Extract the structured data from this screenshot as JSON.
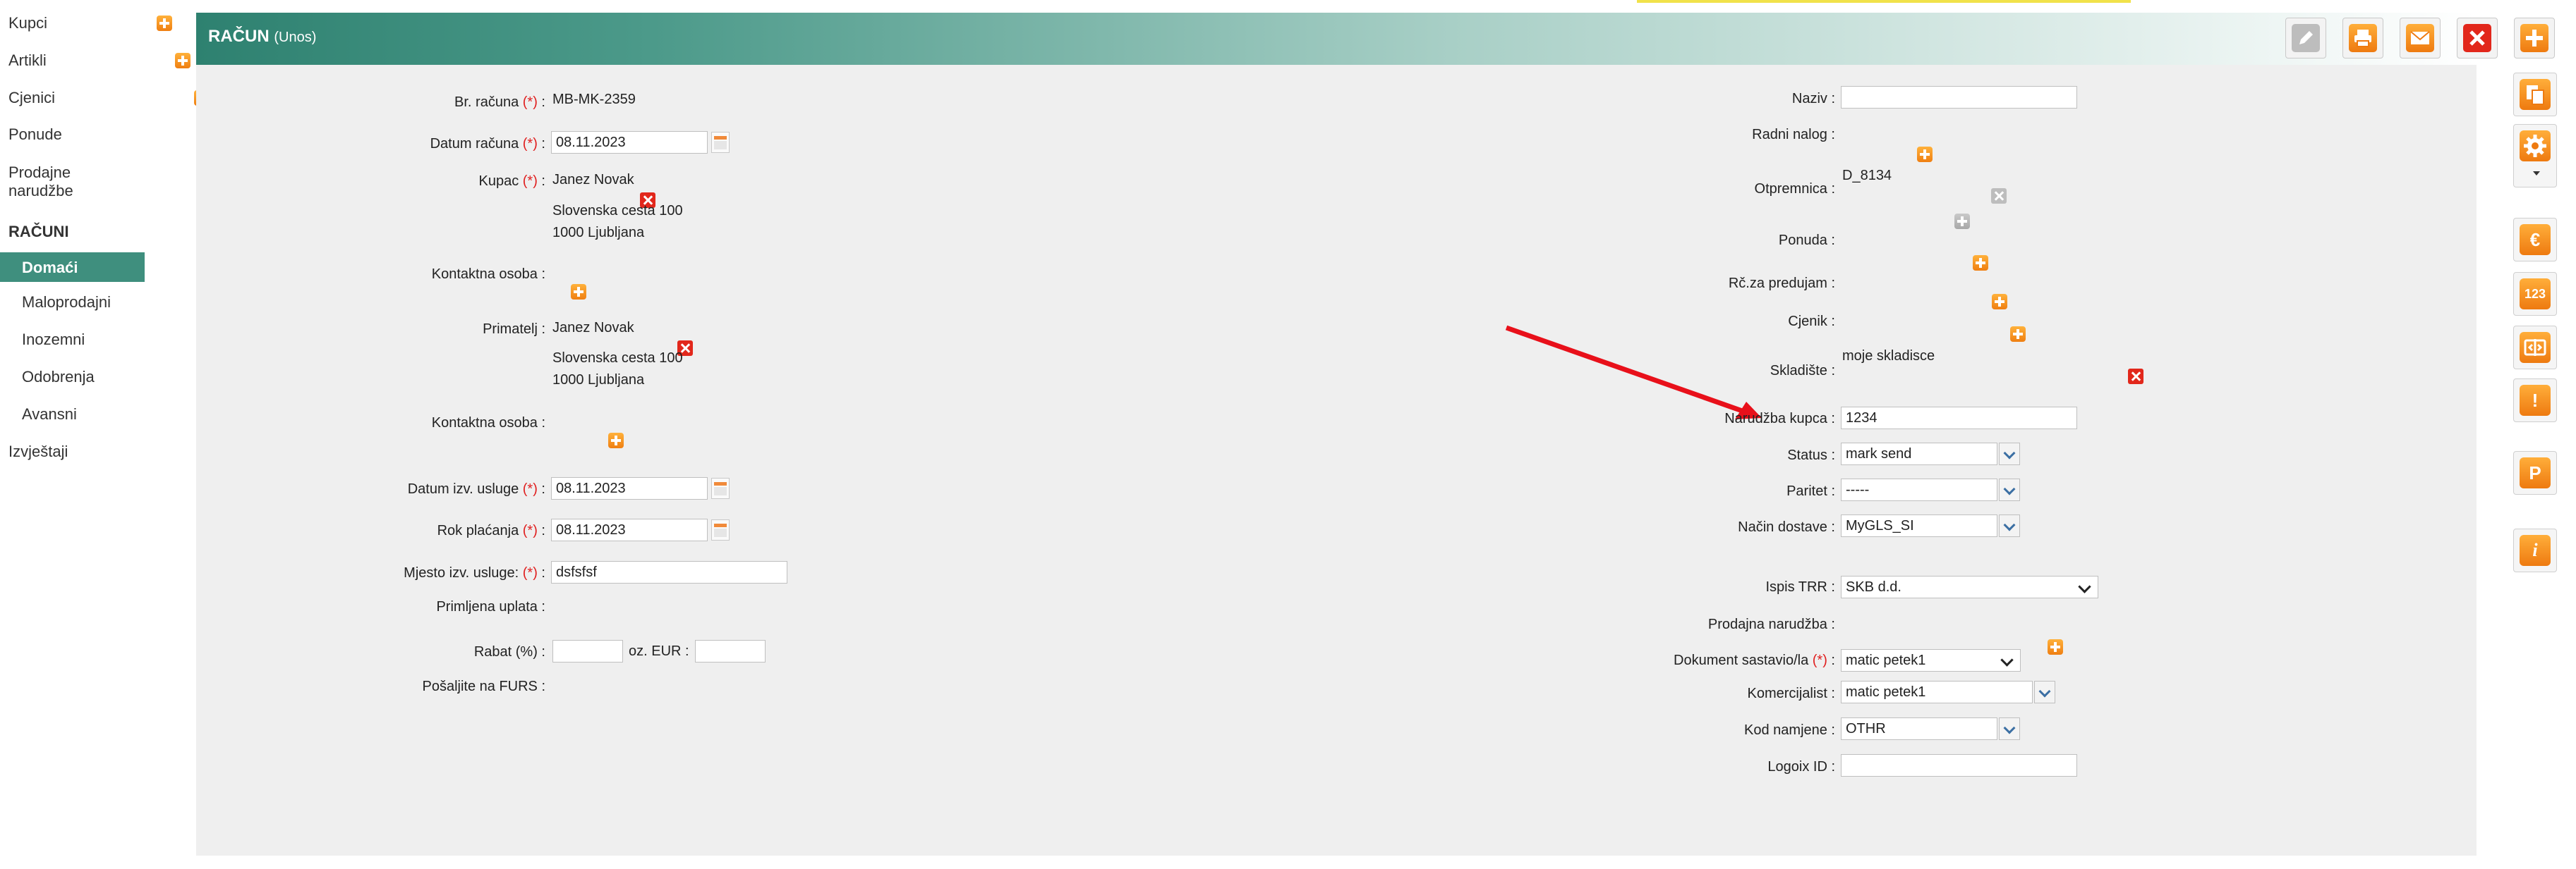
{
  "sidebar": {
    "items": [
      {
        "label": "Kupci"
      },
      {
        "label": "Artikli"
      },
      {
        "label": "Cjenici"
      },
      {
        "label": "Ponude"
      },
      {
        "label": "Prodajne narudžbe"
      }
    ],
    "section_title": "RAČUNI",
    "sub_items": [
      {
        "label": "Domaći",
        "active": true
      },
      {
        "label": "Maloprodajni"
      },
      {
        "label": "Inozemni"
      },
      {
        "label": "Odobrenja"
      },
      {
        "label": "Avansni"
      }
    ],
    "footer_item": "Izvještaji"
  },
  "header": {
    "title": "RAČUN",
    "subtitle": "(Unos)",
    "accent_color": "#2e8170"
  },
  "toolbar": {
    "buttons": [
      "edit-icon",
      "print-icon",
      "email-icon",
      "close-icon",
      "add-icon"
    ]
  },
  "form_left": {
    "br_racuna": {
      "label": "Br. računa",
      "req": "(*)",
      "value": "MB-MK-2359"
    },
    "datum_racuna": {
      "label": "Datum računa",
      "req": "(*)",
      "value": "08.11.2023"
    },
    "kupac": {
      "label": "Kupac",
      "req": "(*)",
      "name": "Janez Novak",
      "address1": "Slovenska cesta 100",
      "address2": "1000 Ljubljana"
    },
    "kontaktna_osoba_1": {
      "label": "Kontaktna osoba :"
    },
    "primatelj": {
      "label": "Primatelj :",
      "name": "Janez Novak",
      "address1": "Slovenska cesta 100",
      "address2": "1000 Ljubljana"
    },
    "kontaktna_osoba_2": {
      "label": "Kontaktna osoba :"
    },
    "datum_izv_usluge": {
      "label": "Datum izv. usluge",
      "req": "(*)",
      "value": "08.11.2023"
    },
    "rok_placanja": {
      "label": "Rok plaćanja",
      "req": "(*)",
      "value": "08.11.2023"
    },
    "mjesto_izv_usluge": {
      "label": "Mjesto izv. usluge:",
      "req": "(*)",
      "value": "dsfsfsf"
    },
    "primljena_uplata": {
      "label": "Primljena uplata :"
    },
    "rabat": {
      "label": "Rabat (%) :",
      "value": "",
      "oz_label": "oz. EUR :",
      "eur_value": ""
    },
    "posaljite_furs": {
      "label": "Pošaljite na FURS :"
    }
  },
  "form_right": {
    "naziv": {
      "label": "Naziv :",
      "value": ""
    },
    "radni_nalog": {
      "label": "Radni nalog :"
    },
    "otpremnica": {
      "label": "Otpremnica :",
      "value": "D_8134"
    },
    "ponuda": {
      "label": "Ponuda :"
    },
    "rc_za_predujam": {
      "label": "Rč.za predujam :"
    },
    "cjenik": {
      "label": "Cjenik :"
    },
    "skladiste": {
      "label": "Skladište :",
      "value": "moje skladisce"
    },
    "narudzba_kupca": {
      "label": "Narudžba kupca :",
      "value": "1234"
    },
    "status": {
      "label": "Status :",
      "value": "mark send"
    },
    "paritet": {
      "label": "Paritet :",
      "value": "-----"
    },
    "nacin_dostave": {
      "label": "Način dostave :",
      "value": "MyGLS_SI"
    },
    "ispis_trr": {
      "label": "Ispis TRR :",
      "value": "SKB d.d."
    },
    "prodajna_narudzba": {
      "label": "Prodajna narudžba :"
    },
    "dokument_sastavio": {
      "label": "Dokument sastavio/la",
      "req": "(*)",
      "value": "matic petek1"
    },
    "komercijalist": {
      "label": "Komercijalist :",
      "value": "matic petek1"
    },
    "kod_namjene": {
      "label": "Kod namjene :",
      "value": "OTHR"
    },
    "logoix_id": {
      "label": "Logoix ID :",
      "value": ""
    }
  },
  "right_toolbar": {
    "buttons": [
      "copy-icon",
      "settings-icon",
      "euro-icon",
      "numbers-icon",
      "split-icon",
      "warning-icon",
      "p-icon",
      "info-icon"
    ],
    "euro_glyph": "€",
    "numbers_glyph": "123",
    "warning_glyph": "!",
    "p_glyph": "P",
    "info_glyph": "i"
  }
}
